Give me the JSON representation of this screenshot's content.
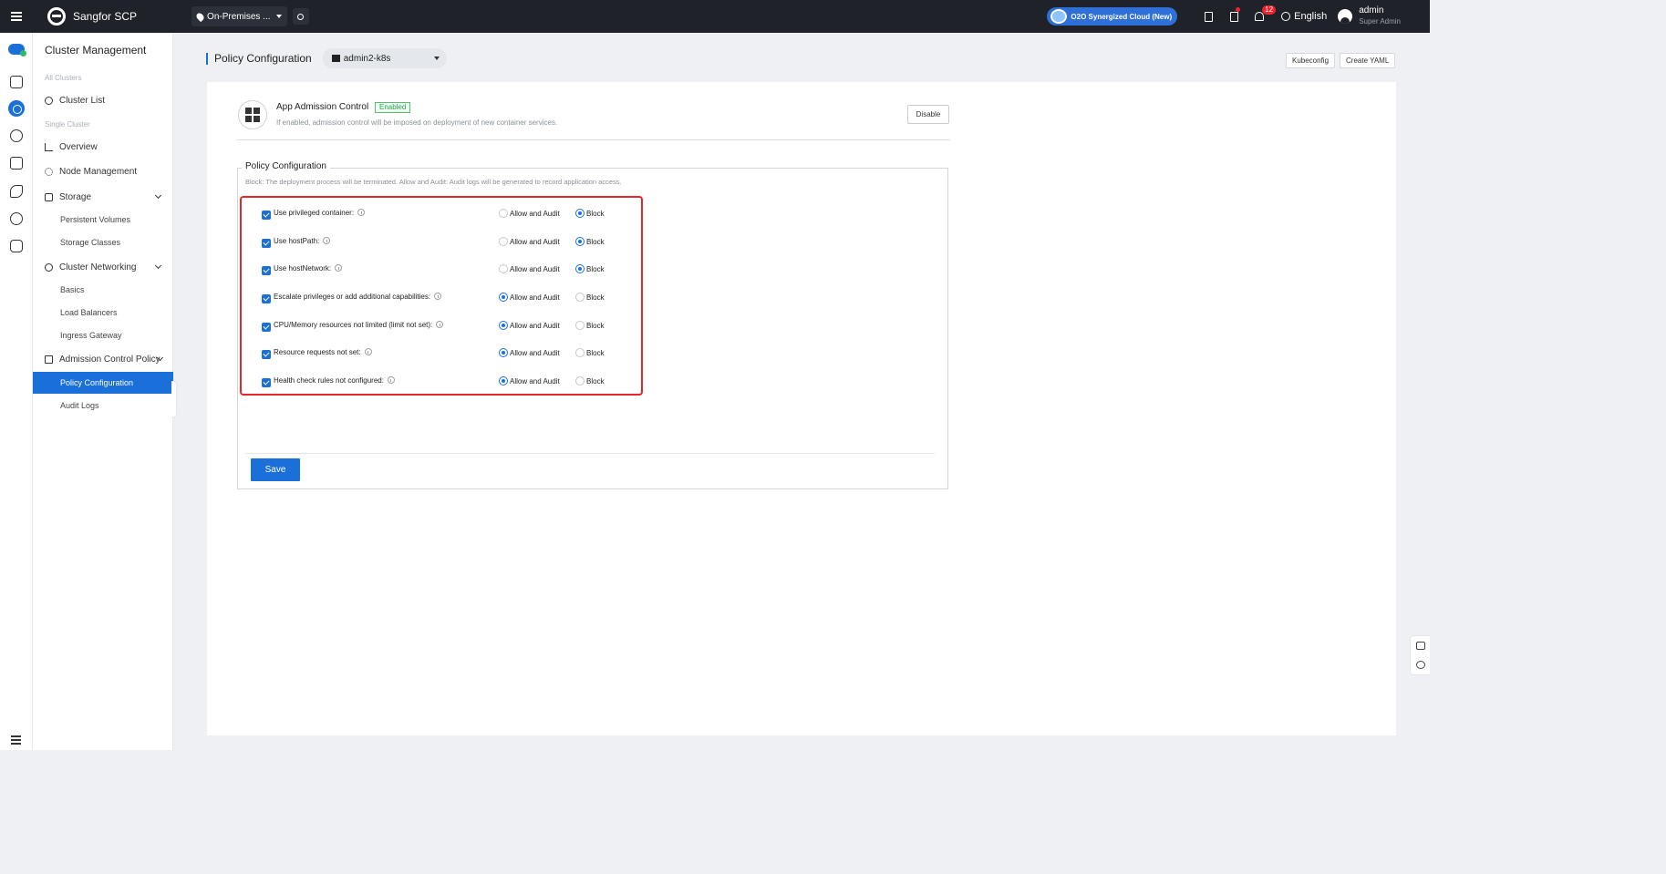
{
  "topbar": {
    "brand": "Sangfor SCP",
    "location": "On-Premises ...",
    "cloud_pill": "O2O Synergized Cloud (New)",
    "notification_count": "12",
    "language": "English",
    "user_name": "admin",
    "user_role": "Super Admin"
  },
  "sidebar": {
    "title": "Cluster Management",
    "section_all": "All Clusters",
    "cluster_list": "Cluster List",
    "section_single": "Single Cluster",
    "overview": "Overview",
    "node_management": "Node Management",
    "storage": "Storage",
    "persistent_volumes": "Persistent Volumes",
    "storage_classes": "Storage Classes",
    "cluster_networking": "Cluster Networking",
    "basics": "Basics",
    "load_balancers": "Load Balancers",
    "ingress_gateway": "Ingress Gateway",
    "admission_control_policy": "Admission Control Policy",
    "policy_configuration": "Policy Configuration",
    "audit_logs": "Audit Logs"
  },
  "header": {
    "title": "Policy Configuration",
    "cluster": "admin2-k8s",
    "kubeconfig": "Kubeconfig",
    "create_yaml": "Create YAML"
  },
  "admission": {
    "title": "App Admission Control",
    "status": "Enabled",
    "description": "If enabled, admission control will be imposed on deployment of new container services.",
    "disable_label": "Disable"
  },
  "policy": {
    "legend": "Policy Configuration",
    "note": "Block: The deployment process will be terminated. Allow and Audit: Audit logs will be generated to record application access.",
    "option_allow": "Allow and Audit",
    "option_block": "Block",
    "rules": [
      {
        "label": "Use privileged container:",
        "checked": true,
        "selected": "Block"
      },
      {
        "label": "Use hostPath:",
        "checked": true,
        "selected": "Block"
      },
      {
        "label": "Use hostNetwork:",
        "checked": true,
        "selected": "Block"
      },
      {
        "label": "Escalate privileges or add additional capabilities:",
        "checked": true,
        "selected": "Allow and Audit"
      },
      {
        "label": "CPU/Memory resources not limited (limit not set):",
        "checked": true,
        "selected": "Allow and Audit"
      },
      {
        "label": "Resource requests not set:",
        "checked": true,
        "selected": "Allow and Audit"
      },
      {
        "label": "Health check rules not configured:",
        "checked": true,
        "selected": "Allow and Audit"
      }
    ],
    "save_label": "Save"
  },
  "colors": {
    "accent": "#1a6fd9",
    "topbar": "#1f2329",
    "highlight": "#e5262a",
    "enabled": "#2ba24c"
  }
}
